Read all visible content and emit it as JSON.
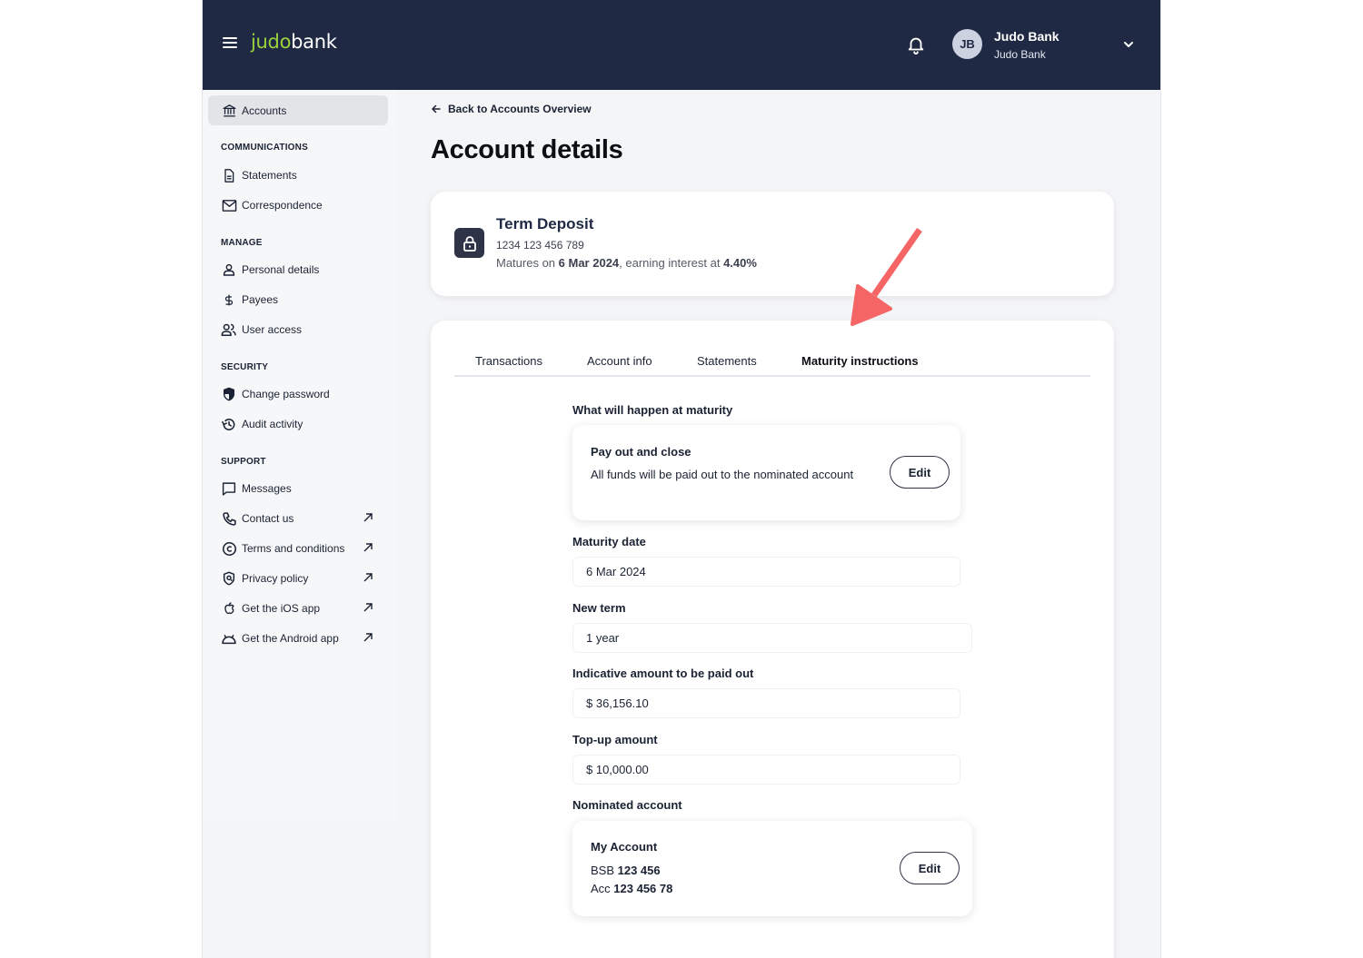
{
  "header": {
    "logo": {
      "part1": "judo",
      "part2": "bank"
    },
    "user": {
      "initials": "JB",
      "name": "Judo Bank",
      "organisation": "Judo Bank"
    },
    "colors": {
      "background": "#1f2944",
      "logo_accent": "#9bd23c"
    }
  },
  "sidebar": {
    "active_item": {
      "label": "Accounts",
      "icon": "bank-icon"
    },
    "sections": [
      {
        "title": "COMMUNICATIONS",
        "items": [
          {
            "label": "Statements",
            "icon": "document-icon",
            "external": false
          },
          {
            "label": "Correspondence",
            "icon": "envelope-icon",
            "external": false
          }
        ]
      },
      {
        "title": "MANAGE",
        "items": [
          {
            "label": "Personal details",
            "icon": "person-icon",
            "external": false
          },
          {
            "label": "Payees",
            "icon": "dollar-icon",
            "external": false
          },
          {
            "label": "User access",
            "icon": "users-icon",
            "external": false
          }
        ]
      },
      {
        "title": "SECURITY",
        "items": [
          {
            "label": "Change password",
            "icon": "shield-icon",
            "external": false
          },
          {
            "label": "Audit activity",
            "icon": "history-icon",
            "external": false
          }
        ]
      },
      {
        "title": "SUPPORT",
        "items": [
          {
            "label": "Messages",
            "icon": "message-icon",
            "external": false
          },
          {
            "label": "Contact us",
            "icon": "phone-icon",
            "external": true
          },
          {
            "label": "Terms and conditions",
            "icon": "copyright-icon",
            "external": true
          },
          {
            "label": "Privacy policy",
            "icon": "privacy-shield-icon",
            "external": true
          },
          {
            "label": "Get the iOS app",
            "icon": "apple-icon",
            "external": true
          },
          {
            "label": "Get the Android app",
            "icon": "android-icon",
            "external": true
          }
        ]
      }
    ]
  },
  "main": {
    "back_link": "Back to Accounts Overview",
    "title": "Account details",
    "account": {
      "name": "Term Deposit",
      "number": "1234 123 456 789",
      "maturity_prefix": "Matures on ",
      "maturity_date": "6 Mar 2024",
      "interest_prefix": ", earning interest at ",
      "interest_rate": "4.40%"
    },
    "tabs": [
      {
        "label": "Transactions",
        "active": false
      },
      {
        "label": "Account info",
        "active": false
      },
      {
        "label": "Statements",
        "active": false
      },
      {
        "label": "Maturity instructions",
        "active": true
      }
    ],
    "maturity": {
      "section_label": "What will happen at maturity",
      "option_title": "Pay out and close",
      "option_description": "All funds will be paid out to the nominated account",
      "edit_label": "Edit"
    },
    "fields": [
      {
        "label": "Maturity date",
        "value": "6 Mar 2024"
      },
      {
        "label": "New term",
        "value": "1 year"
      },
      {
        "label": "Indicative amount to be paid out",
        "value": "$ 36,156.10"
      },
      {
        "label": "Top-up amount",
        "value": "$ 10,000.00"
      }
    ],
    "nominated": {
      "section_label": "Nominated account",
      "name": "My Account",
      "bsb_label": "BSB ",
      "bsb": "123 456",
      "acc_label": "Acc ",
      "acc": "123 456 78",
      "edit_label": "Edit"
    }
  },
  "annotation": {
    "type": "arrow",
    "color": "#f56565",
    "points_to": "Maturity instructions tab"
  }
}
